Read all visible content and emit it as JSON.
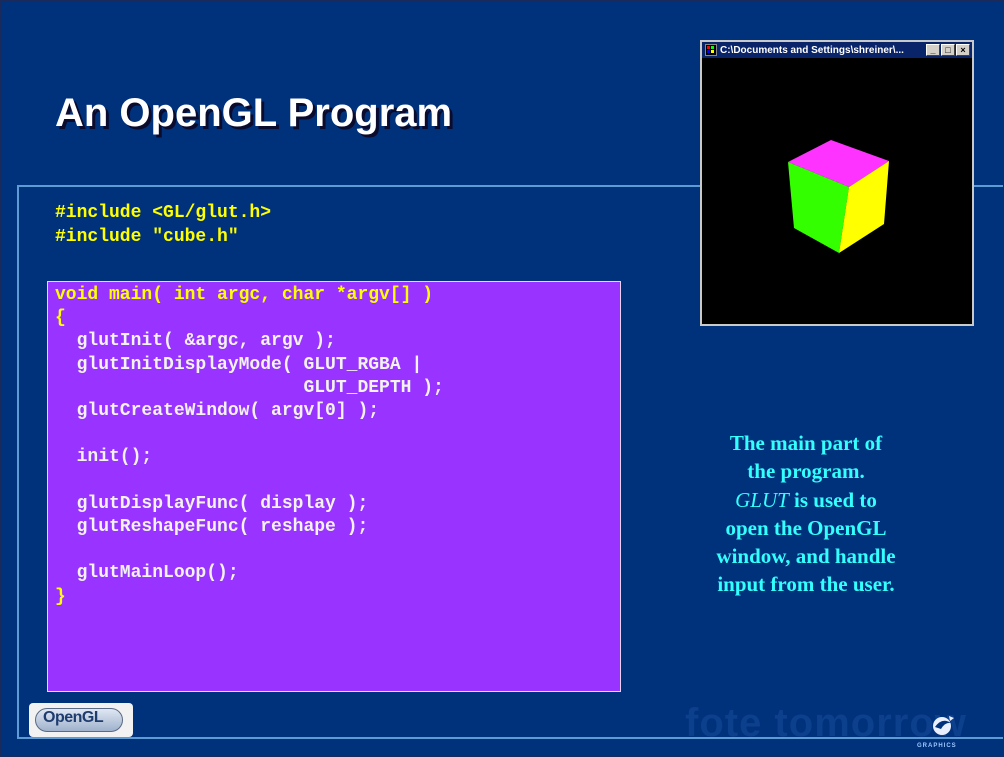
{
  "slide": {
    "title": "An OpenGL Program",
    "includes": [
      "#include <GL/glut.h>",
      "#include \"cube.h\""
    ],
    "code_lines": [
      {
        "text": "void main( int argc, char *argv[] )",
        "color": "yellow"
      },
      {
        "text": "{",
        "color": "yellow"
      },
      {
        "text": "  glutInit( &argc, argv );",
        "color": "white"
      },
      {
        "text": "  glutInitDisplayMode( GLUT_RGBA |",
        "color": "white"
      },
      {
        "text": "                       GLUT_DEPTH );",
        "color": "white"
      },
      {
        "text": "  glutCreateWindow( argv[0] );",
        "color": "white"
      },
      {
        "text": "",
        "color": "white"
      },
      {
        "text": "  init();",
        "color": "white"
      },
      {
        "text": "",
        "color": "white"
      },
      {
        "text": "  glutDisplayFunc( display );",
        "color": "white"
      },
      {
        "text": "  glutReshapeFunc( reshape );",
        "color": "white"
      },
      {
        "text": "",
        "color": "white"
      },
      {
        "text": "  glutMainLoop();",
        "color": "white"
      },
      {
        "text": "}",
        "color": "yellow"
      }
    ],
    "description": {
      "line1": "The main part of",
      "line2": "the program.",
      "line3_italic": "GLUT",
      "line3_rest": " is used to",
      "line4": "open the OpenGL",
      "line5": "window, and handle",
      "line6": "input from the user."
    }
  },
  "window": {
    "title": "C:\\Documents and Settings\\shreiner\\...",
    "minimize": "_",
    "maximize": "□",
    "close": "×",
    "cube_colors": {
      "top": "#ff33ff",
      "left": "#33ff00",
      "right": "#ffff00"
    }
  },
  "logo": {
    "text": "OpenGL"
  },
  "watermark": {
    "text": "fote tomorrow"
  },
  "brand": {
    "text": "GRAPHICS"
  },
  "colors": {
    "background": "#00317b",
    "code_box": "#9933ff",
    "code_highlight": "#ffff00",
    "description": "#33ffff"
  },
  "icons": [
    "window-app-icon",
    "minimize-icon",
    "maximize-icon",
    "close-icon",
    "brand-swirl-icon"
  ]
}
